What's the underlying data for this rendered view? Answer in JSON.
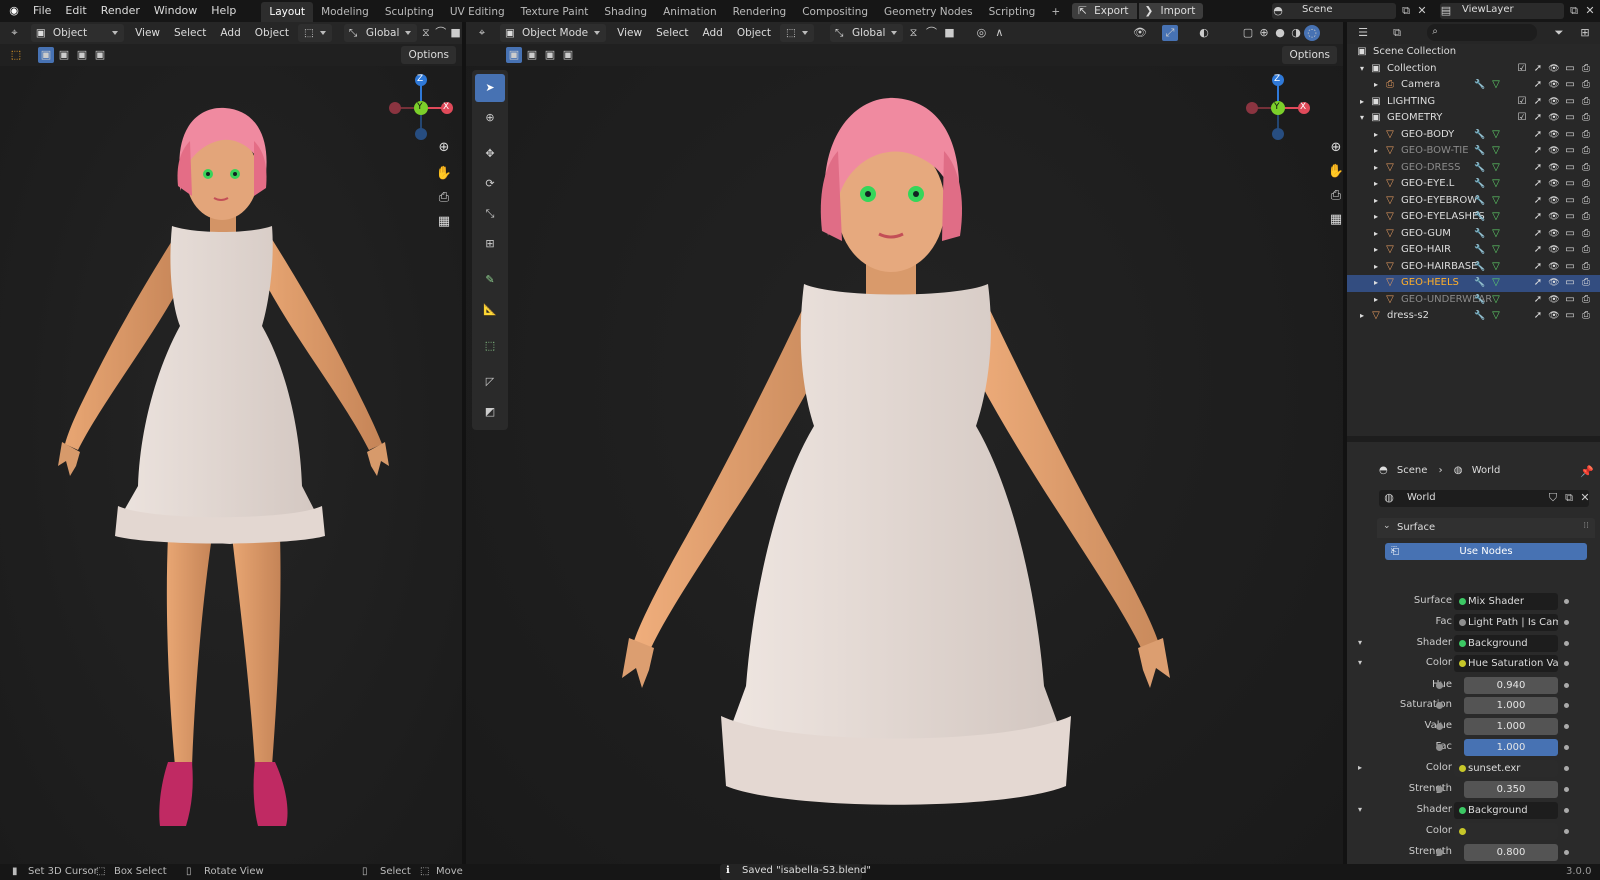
{
  "topbar": {
    "menus": [
      "File",
      "Edit",
      "Render",
      "Window",
      "Help"
    ],
    "workspaces": [
      "Layout",
      "Modeling",
      "Sculpting",
      "UV Editing",
      "Texture Paint",
      "Shading",
      "Animation",
      "Rendering",
      "Compositing",
      "Geometry Nodes",
      "Scripting"
    ],
    "active_workspace": "Layout",
    "add_tab": "+",
    "export_label": "Export",
    "import_label": "Import",
    "scene_name": "Scene",
    "view_layer": "ViewLayer"
  },
  "viewport_left": {
    "mode": "Object Mode",
    "menus": [
      "View",
      "Select",
      "Add",
      "Object"
    ],
    "orientation": "Global",
    "options": "Options"
  },
  "viewport_right": {
    "mode": "Object Mode",
    "menus": [
      "View",
      "Select",
      "Add",
      "Object"
    ],
    "orientation": "Global",
    "options": "Options"
  },
  "gizmo": {
    "z": "Z",
    "y": "Y",
    "x": "X"
  },
  "outliner": {
    "rows": [
      {
        "name": "Scene Collection",
        "indent": 0,
        "icon": "collection-icon",
        "state": "normal"
      },
      {
        "name": "Collection",
        "indent": 1,
        "icon": "collection-icon",
        "state": "normal"
      },
      {
        "name": "Camera",
        "indent": 2,
        "icon": "camera-icon",
        "state": "normal"
      },
      {
        "name": "LIGHTING",
        "indent": 1,
        "icon": "collection-icon",
        "state": "normal"
      },
      {
        "name": "GEOMETRY",
        "indent": 1,
        "icon": "collection-icon",
        "state": "normal"
      },
      {
        "name": "GEO-BODY",
        "indent": 2,
        "icon": "mesh-icon",
        "state": "normal"
      },
      {
        "name": "GEO-BOW-TIE",
        "indent": 2,
        "icon": "mesh-icon",
        "state": "dim"
      },
      {
        "name": "GEO-DRESS",
        "indent": 2,
        "icon": "mesh-icon",
        "state": "dim"
      },
      {
        "name": "GEO-EYE.L",
        "indent": 2,
        "icon": "mesh-icon",
        "state": "normal"
      },
      {
        "name": "GEO-EYEBROW",
        "indent": 2,
        "icon": "mesh-icon",
        "state": "normal"
      },
      {
        "name": "GEO-EYELASHES",
        "indent": 2,
        "icon": "mesh-icon",
        "state": "normal"
      },
      {
        "name": "GEO-GUM",
        "indent": 2,
        "icon": "mesh-icon",
        "state": "normal"
      },
      {
        "name": "GEO-HAIR",
        "indent": 2,
        "icon": "mesh-icon",
        "state": "normal"
      },
      {
        "name": "GEO-HAIRBASE",
        "indent": 2,
        "icon": "mesh-icon",
        "state": "normal"
      },
      {
        "name": "GEO-HEELS",
        "indent": 2,
        "icon": "mesh-icon",
        "state": "selected"
      },
      {
        "name": "GEO-UNDERWEAR",
        "indent": 2,
        "icon": "mesh-icon",
        "state": "dim"
      },
      {
        "name": "dress-s2",
        "indent": 1,
        "icon": "mesh-icon",
        "state": "normal"
      }
    ]
  },
  "properties": {
    "breadcrumb_scene": "Scene",
    "breadcrumb_world": "World",
    "world_name": "World",
    "panel_surface": "Surface",
    "use_nodes": "Use Nodes",
    "fields": [
      {
        "label": "Surface",
        "value": "Mix Shader",
        "kind": "socket",
        "dot": "#3cc864",
        "tri": ""
      },
      {
        "label": "Fac",
        "value": "Light Path | Is Came...",
        "kind": "socket",
        "dot": "#8f8f8f",
        "tri": ""
      },
      {
        "label": "Shader",
        "value": "Background",
        "kind": "socket",
        "dot": "#3cc864",
        "tri": "▾"
      },
      {
        "label": "Color",
        "value": "Hue Saturation Value",
        "kind": "socket",
        "dot": "#c7c729",
        "tri": "▾"
      },
      {
        "label": "Hue",
        "value": "0.940",
        "kind": "num",
        "dot": "",
        "tri": ""
      },
      {
        "label": "Saturation",
        "value": "1.000",
        "kind": "num",
        "dot": "",
        "tri": ""
      },
      {
        "label": "Value",
        "value": "1.000",
        "kind": "num",
        "dot": "",
        "tri": ""
      },
      {
        "label": "Fac",
        "value": "1.000",
        "kind": "numblue",
        "dot": "",
        "tri": ""
      },
      {
        "label": "Color",
        "value": "sunset.exr",
        "kind": "socketdark",
        "dot": "#c7c729",
        "tri": "▸"
      },
      {
        "label": "Strength",
        "value": "0.350",
        "kind": "num",
        "dot": "",
        "tri": ""
      },
      {
        "label": "Shader",
        "value": "Background",
        "kind": "socket",
        "dot": "#3cc864",
        "tri": "▾"
      },
      {
        "label": "Color",
        "value": "",
        "kind": "socketdark",
        "dot": "#c7c729",
        "tri": ""
      },
      {
        "label": "Strength",
        "value": "0.800",
        "kind": "num",
        "dot": "",
        "tri": ""
      }
    ]
  },
  "statusbar": {
    "set_cursor": "Set 3D Cursor",
    "box_select": "Box Select",
    "rotate_view": "Rotate View",
    "select": "Select",
    "move": "Move",
    "message": "Saved \"isabella-S3.blend\"",
    "version": "3.0.0"
  }
}
